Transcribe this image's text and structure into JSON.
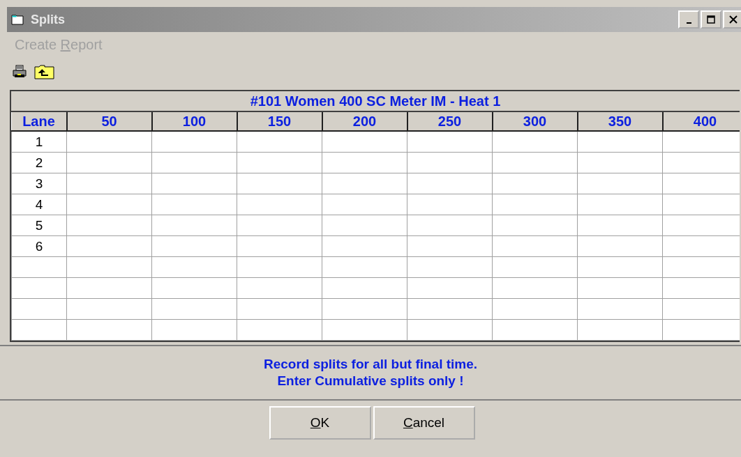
{
  "window": {
    "title": "Splits"
  },
  "menu": [
    {
      "label": [
        {
          "text": "Create ",
          "underline": false
        },
        {
          "text": "R",
          "underline": true
        },
        {
          "text": "eport",
          "underline": false
        }
      ],
      "disabled": true
    }
  ],
  "grid": {
    "title": "#101 Women 400 SC Meter IM - Heat 1",
    "columns": [
      "Lane",
      "50",
      "100",
      "150",
      "200",
      "250",
      "300",
      "350",
      "400"
    ],
    "rows": [
      {
        "lane": "1"
      },
      {
        "lane": "2"
      },
      {
        "lane": "3"
      },
      {
        "lane": "4"
      },
      {
        "lane": "5"
      },
      {
        "lane": "6"
      }
    ]
  },
  "message": [
    "Record splits for all but final time.",
    "Enter Cumulative splits only !"
  ],
  "buttons": [
    {
      "label": [
        {
          "text": "O",
          "underline": true
        },
        {
          "text": "K",
          "underline": false
        }
      ]
    },
    {
      "label": [
        {
          "text": "C",
          "underline": true
        },
        {
          "text": "ancel",
          "underline": false
        }
      ]
    }
  ]
}
